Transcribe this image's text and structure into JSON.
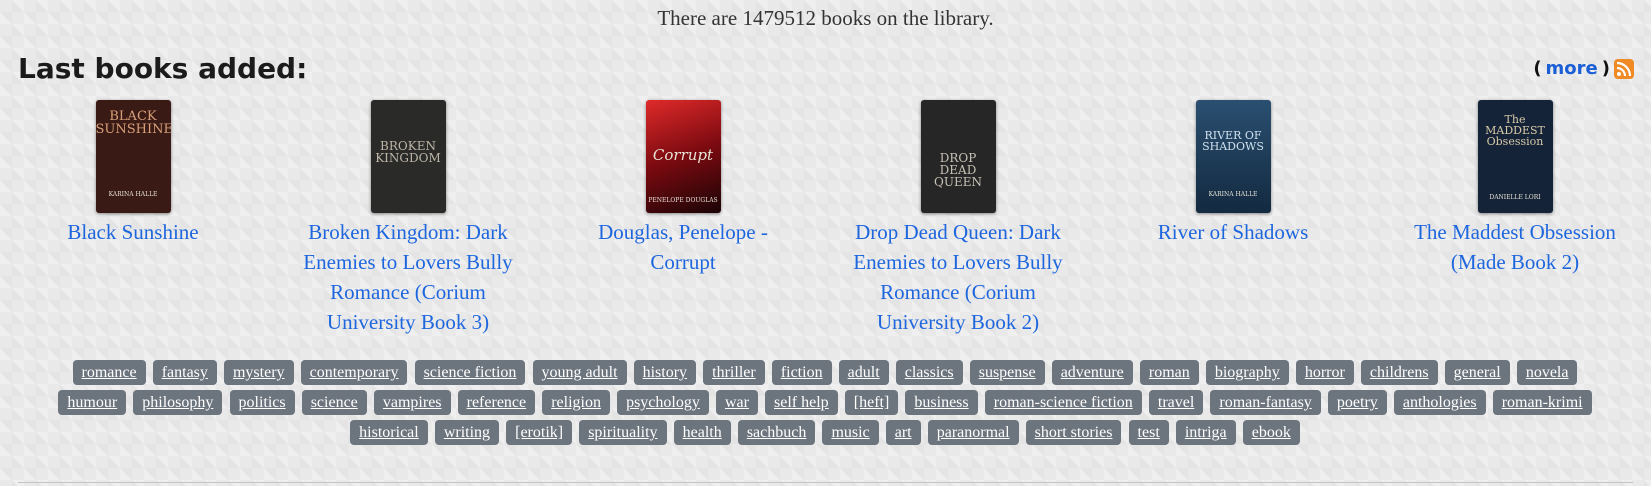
{
  "library": {
    "count_text": "There are 1479512 books on the library."
  },
  "section": {
    "title": "Last books added:",
    "more_open": "(",
    "more_label": "more",
    "more_close": ")",
    "rss_icon": "rss-feed-icon"
  },
  "books": [
    {
      "title": "Black Sunshine",
      "cover_text": "BLACK SUNSHINE",
      "cover_author": "KARINA HALLE",
      "cover_color": "#3a1a14"
    },
    {
      "title": "Broken Kingdom: Dark Enemies to Lovers Bully Romance (Corium University Book 3)",
      "cover_text": "BROKEN KINGDOM",
      "cover_author": "",
      "cover_color": "#2a2a28"
    },
    {
      "title": "Douglas, Penelope - Corrupt",
      "cover_text": "Corrupt",
      "cover_author": "PENELOPE DOUGLAS",
      "cover_color": "#b0131c"
    },
    {
      "title": "Drop Dead Queen: Dark Enemies to Lovers Bully Romance (Corium University Book 2)",
      "cover_text": "DROP DEAD QUEEN",
      "cover_author": "",
      "cover_color": "#262626"
    },
    {
      "title": "River of Shadows",
      "cover_text": "RIVER OF SHADOWS",
      "cover_author": "KARINA HALLE",
      "cover_color": "#1d3a55"
    },
    {
      "title": "The Maddest Obsession (Made Book 2)",
      "cover_text": "The MADDEST Obsession",
      "cover_author": "DANIELLE LORI",
      "cover_color": "#142338"
    }
  ],
  "tags": [
    [
      "romance",
      "fantasy",
      "mystery",
      "contemporary",
      "science fiction",
      "young adult",
      "history",
      "thriller",
      "fiction",
      "adult",
      "classics",
      "suspense",
      "adventure",
      "roman",
      "biography",
      "horror",
      "childrens",
      "general",
      "novela"
    ],
    [
      "humour",
      "philosophy",
      "politics",
      "science",
      "vampires",
      "reference",
      "religion",
      "psychology",
      "war",
      "self help",
      "[heft]",
      "business",
      "roman-science fiction",
      "travel",
      "roman-fantasy",
      "poetry",
      "anthologies",
      "roman-krimi"
    ],
    [
      "historical",
      "writing",
      "[erotik]",
      "spirituality",
      "health",
      "sachbuch",
      "music",
      "art",
      "paranormal",
      "short stories",
      "test",
      "intriga",
      "ebook"
    ]
  ],
  "colors": {
    "link": "#1e66de",
    "tag_bg": "#6c747d",
    "rss": "#f08a24"
  }
}
